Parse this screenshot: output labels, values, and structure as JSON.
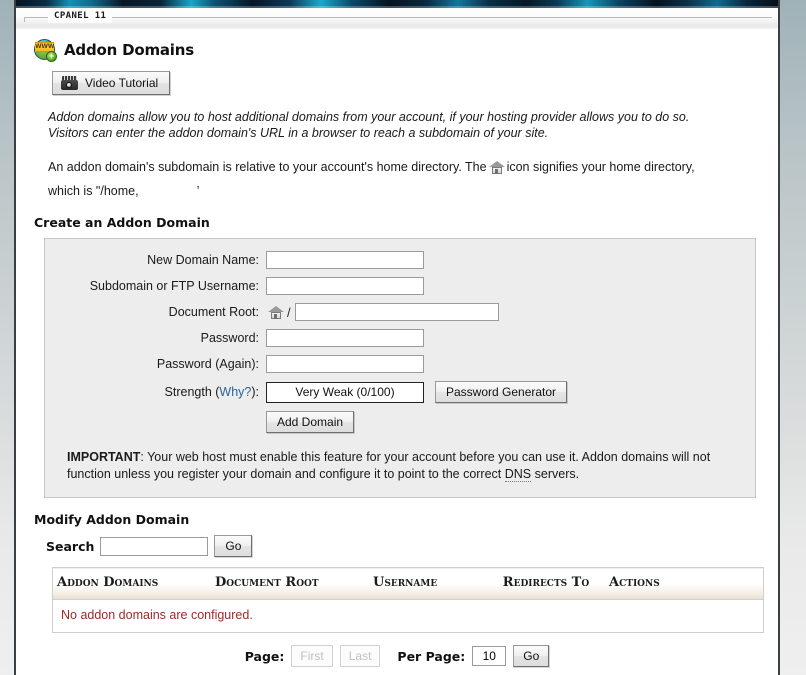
{
  "window": {
    "legend": "CPANEL 11"
  },
  "header": {
    "title": "Addon Domains",
    "icon": "www-globe-add-icon",
    "video_tutorial_label": "Video Tutorial",
    "video_tutorial_icon": "video-camera-icon"
  },
  "intro": {
    "italic_line_1": "Addon domains allow you to host additional domains from your account, if your hosting provider allows you to do so.",
    "italic_line_2": "Visitors can enter the addon domain's URL in a browser to reach a subdomain of your site.",
    "plain_before_icon": "An addon domain's subdomain is relative to your account's home directory. The",
    "home_icon": "home-icon",
    "plain_after_icon": "icon signifies your home directory,",
    "plain_line_2_prefix": "which is \"/home,",
    "plain_line_2_suffix": "’"
  },
  "create_section": {
    "heading": "Create an Addon Domain",
    "fields": [
      {
        "label": "New Domain Name:",
        "value": "",
        "placeholder": "",
        "name": "new-domain-name"
      },
      {
        "label": "Subdomain or FTP Username:",
        "value": "",
        "placeholder": "",
        "name": "subdomain-ftp-username"
      },
      {
        "label": "Document Root:",
        "value": "",
        "placeholder": "",
        "name": "document-root"
      },
      {
        "label": "Password:",
        "value": "",
        "placeholder": "",
        "name": "password"
      },
      {
        "label": "Password (Again):",
        "value": "",
        "placeholder": "",
        "name": "password-again"
      }
    ],
    "docroot_slash": "/",
    "strength_label_prefix": "Strength (",
    "strength_why_link": "Why?",
    "strength_label_suffix": "):",
    "strength_value": "Very Weak (0/100)",
    "password_generator_label": "Password Generator",
    "add_domain_label": "Add Domain",
    "important_bold": "IMPORTANT",
    "important_text_1": ": Your web host must enable this feature for your account before you can use it. Addon domains will not function unless you register your domain and configure it to point to the correct ",
    "important_abbr": "DNS",
    "important_text_2": " servers."
  },
  "modify_section": {
    "heading": "Modify Addon Domain",
    "search_label": "Search",
    "search_value": "",
    "search_placeholder": "",
    "search_go_label": "Go",
    "table": {
      "columns": [
        "Addon Domains",
        "Document Root",
        "Username",
        "Redirects To",
        "Actions"
      ],
      "rows": [],
      "empty_message": "No addon domains are configured."
    },
    "pagination": {
      "page_label": "Page:",
      "first_label": "First",
      "last_label": "Last",
      "per_page_label": "Per Page:",
      "per_page_value": "10",
      "go_label": "Go"
    }
  },
  "colors": {
    "panel_bg": "#ededed",
    "link": "#2a6496",
    "error_text": "#9c2a2a",
    "banner_dark": "#061423",
    "banner_accent": "#17a6c6"
  }
}
